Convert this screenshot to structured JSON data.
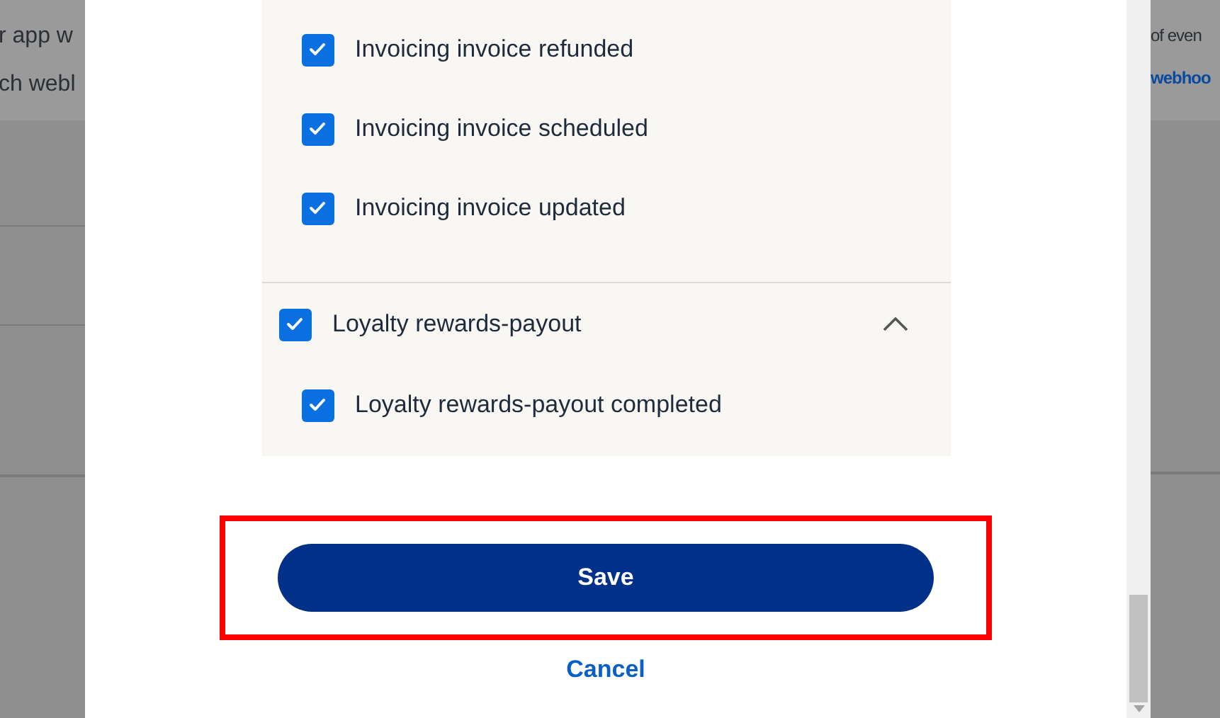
{
  "background": {
    "left_lines": [
      "r app w",
      "ch webl"
    ],
    "right_lines": [
      "of even"
    ],
    "right_link": "webhoo"
  },
  "event_groups": [
    {
      "kind": "continued",
      "children": [
        {
          "label": "Invoicing invoice refunded",
          "checked": true
        },
        {
          "label": "Invoicing invoice scheduled",
          "checked": true
        },
        {
          "label": "Invoicing invoice updated",
          "checked": true
        }
      ]
    },
    {
      "kind": "group",
      "label": "Loyalty rewards-payout",
      "checked": true,
      "expanded": true,
      "children": [
        {
          "label": "Loyalty rewards-payout completed",
          "checked": true
        }
      ]
    }
  ],
  "save_button": "Save",
  "cancel_link": "Cancel",
  "highlight": true
}
